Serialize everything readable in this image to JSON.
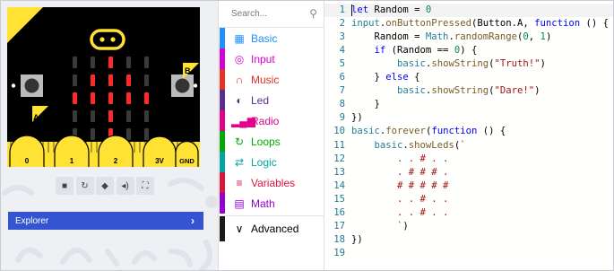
{
  "simulator": {
    "pins": [
      "0",
      "1",
      "2",
      "3V",
      "GND"
    ],
    "button_a_label": "A",
    "button_b_label": "B",
    "led_matrix": [
      [
        0,
        0,
        1,
        0,
        0
      ],
      [
        0,
        1,
        1,
        1,
        0
      ],
      [
        1,
        1,
        1,
        1,
        1
      ],
      [
        0,
        0,
        1,
        0,
        0
      ],
      [
        0,
        0,
        1,
        0,
        0
      ]
    ],
    "toolbar_icons": [
      "stop-icon",
      "restart-icon",
      "debug-icon",
      "mute-icon",
      "fullscreen-icon"
    ],
    "explorer_label": "Explorer"
  },
  "toolbox": {
    "search_placeholder": "Search...",
    "categories": [
      {
        "label": "Basic",
        "color": "#1e90ff",
        "icon": "grid-icon",
        "glyph": "▦"
      },
      {
        "label": "Input",
        "color": "#d400d4",
        "icon": "target-icon",
        "glyph": "◎"
      },
      {
        "label": "Music",
        "color": "#e63022",
        "icon": "headphones-icon",
        "glyph": "∩"
      },
      {
        "label": "Led",
        "color": "#5c2d91",
        "icon": "toggle-icon",
        "glyph": "◐"
      },
      {
        "label": "Radio",
        "color": "#e3008c",
        "icon": "signal-icon",
        "glyph": "▂▄▆"
      },
      {
        "label": "Loops",
        "color": "#00aa00",
        "icon": "loop-icon",
        "glyph": "↻"
      },
      {
        "label": "Logic",
        "color": "#00a4a6",
        "icon": "shuffle-icon",
        "glyph": "⇄"
      },
      {
        "label": "Variables",
        "color": "#dc143c",
        "icon": "list-icon",
        "glyph": "≡"
      },
      {
        "label": "Math",
        "color": "#9400d3",
        "icon": "calculator-icon",
        "glyph": "▤"
      }
    ],
    "advanced": {
      "label": "Advanced",
      "icon": "chevron-down-icon",
      "glyph": "∨"
    }
  },
  "editor": {
    "lines": [
      {
        "n": "1",
        "tokens": [
          [
            "kw",
            "let"
          ],
          [
            "",
            " Random = "
          ],
          [
            "num",
            "0"
          ]
        ]
      },
      {
        "n": "2",
        "tokens": [
          [
            "obj",
            "input"
          ],
          [
            "",
            "."
          ],
          [
            "fn",
            "onButtonPressed"
          ],
          [
            "",
            "(Button.A, "
          ],
          [
            "kw",
            "function"
          ],
          [
            "",
            " () {"
          ]
        ]
      },
      {
        "n": "3",
        "tokens": [
          [
            "",
            "    Random = "
          ],
          [
            "obj",
            "Math"
          ],
          [
            "",
            "."
          ],
          [
            "fn",
            "randomRange"
          ],
          [
            "",
            "("
          ],
          [
            "num",
            "0"
          ],
          [
            "",
            ", "
          ],
          [
            "num",
            "1"
          ],
          [
            "",
            ")"
          ]
        ]
      },
      {
        "n": "4",
        "tokens": [
          [
            "",
            "    "
          ],
          [
            "kw",
            "if"
          ],
          [
            "",
            " (Random == "
          ],
          [
            "num",
            "0"
          ],
          [
            "",
            ") {"
          ]
        ]
      },
      {
        "n": "5",
        "tokens": [
          [
            "",
            "        "
          ],
          [
            "obj",
            "basic"
          ],
          [
            "",
            "."
          ],
          [
            "fn",
            "showString"
          ],
          [
            "",
            "("
          ],
          [
            "str",
            "\"Truth!\""
          ],
          [
            "",
            ")"
          ]
        ]
      },
      {
        "n": "6",
        "tokens": [
          [
            "",
            "    } "
          ],
          [
            "kw",
            "else"
          ],
          [
            "",
            " {"
          ]
        ]
      },
      {
        "n": "7",
        "tokens": [
          [
            "",
            "        "
          ],
          [
            "obj",
            "basic"
          ],
          [
            "",
            "."
          ],
          [
            "fn",
            "showString"
          ],
          [
            "",
            "("
          ],
          [
            "str",
            "\"Dare!\""
          ],
          [
            "",
            ")"
          ]
        ]
      },
      {
        "n": "8",
        "tokens": [
          [
            "",
            "    }"
          ]
        ]
      },
      {
        "n": "9",
        "tokens": [
          [
            "",
            "})"
          ]
        ]
      },
      {
        "n": "10",
        "tokens": [
          [
            "obj",
            "basic"
          ],
          [
            "",
            "."
          ],
          [
            "fn",
            "forever"
          ],
          [
            "",
            "("
          ],
          [
            "kw",
            "function"
          ],
          [
            "",
            " () {"
          ]
        ]
      },
      {
        "n": "11",
        "tokens": [
          [
            "",
            "    "
          ],
          [
            "obj",
            "basic"
          ],
          [
            "",
            "."
          ],
          [
            "fn",
            "showLeds"
          ],
          [
            "",
            "("
          ],
          [
            "str",
            "`"
          ]
        ]
      },
      {
        "n": "12",
        "tokens": [
          [
            "str",
            "        . . # . ."
          ]
        ]
      },
      {
        "n": "13",
        "tokens": [
          [
            "str",
            "        . # # # ."
          ]
        ]
      },
      {
        "n": "14",
        "tokens": [
          [
            "str",
            "        # # # # #"
          ]
        ]
      },
      {
        "n": "15",
        "tokens": [
          [
            "str",
            "        . . # . ."
          ]
        ]
      },
      {
        "n": "16",
        "tokens": [
          [
            "str",
            "        . . # . ."
          ]
        ]
      },
      {
        "n": "17",
        "tokens": [
          [
            "str",
            "        `"
          ],
          [
            "",
            ")"
          ]
        ]
      },
      {
        "n": "18",
        "tokens": [
          [
            "",
            "})"
          ]
        ]
      },
      {
        "n": "19",
        "tokens": [
          [
            "",
            ""
          ]
        ]
      }
    ]
  }
}
